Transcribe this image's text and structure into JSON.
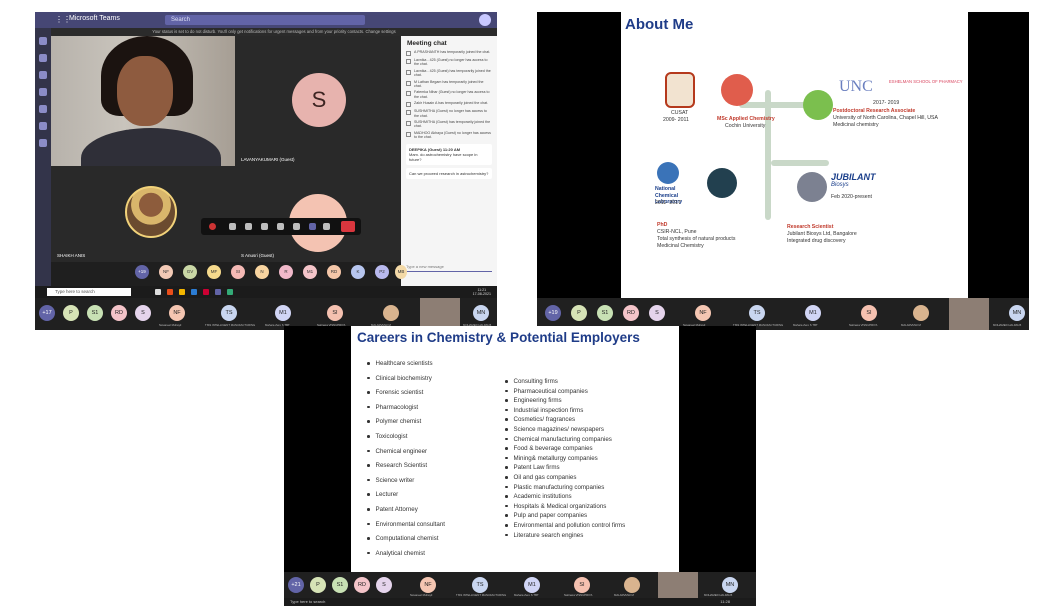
{
  "teams": {
    "app_title": "Microsoft Teams",
    "search_placeholder": "Search",
    "notice": "Your status is set to do not disturb. You'll only get notifications for urgent messages and from your priority contacts. Change settings",
    "tile_woman_label": "",
    "tile_s_label": "LAVANYAKUMARI (Guest)",
    "tile_s_initial": "S",
    "tile_man_label": "SHAIKH ANIS",
    "tile_peach_label": "S Anusri (Guest)",
    "chat_title": "Meeting chat",
    "chat_entries": [
      "A PRASHANTH has temporarily joined the chat.",
      "Lavnika - 425 (Guest) no longer has access to the chat.",
      "Lavnika - 425 (Guest) has temporarily joined the chat.",
      "M Lathan Begam has temporarily joined the chat.",
      "Fatemka Nihar (Guest) no longer has access to the chat.",
      "Zakir Husain A has temporarily joined the chat.",
      "SUSHMITHA (Guest) no longer has access to the chat.",
      "SUSHMITHA (Guest) has temporarily joined the chat.",
      "MADHOO Akhaya (Guest) no longer has access to the chat."
    ],
    "chat_msg_author": "DEEPIKA (Guest)  11:20 AM",
    "chat_msg_1": "Mam. do astrochemistry have scope in future?",
    "chat_msg_2": "Can we proceed research in astrochemistry?",
    "chat_input_placeholder": "Type a new message",
    "participants": [
      "+19",
      "NF",
      "GV",
      "MF",
      "SI",
      "N",
      "R",
      "M1",
      "RD",
      "K",
      "P2",
      "MB"
    ],
    "taskbar_search": "Type here to search",
    "taskbar_time": "11:21",
    "taskbar_date": "17-08-2021"
  },
  "gallery1": {
    "buttons": [
      "+17",
      "P",
      "S1",
      "RD",
      "S",
      "NF",
      "TS",
      "M1",
      "SI",
      "",
      "MN"
    ],
    "names": [
      "Navaneel Muhayil",
      "TISS INTELLIGENT MANUFACTURING",
      "Mahara Zero S TBT",
      "Nalinaxa VISNUPRIYA",
      "MALARVIZHI M",
      "MOHAMED HALIMA B"
    ]
  },
  "about": {
    "title": "About Me",
    "cusat_label": "CUSAT",
    "cusat_years": "2009- 2011",
    "msc_title": "MSc Applied Chemistry",
    "msc_place": "Cochin University",
    "unc_logo": "UNC",
    "unc_school": "ESHELMAN SCHOOL OF PHARMACY",
    "unc_years": "2017- 2019",
    "postdoc_title": "Postdoctoral Research Associate",
    "postdoc_place": "University of North Carolina, Chapel Hill, USA",
    "postdoc_field": "Medicinal chemistry",
    "ncl_name": "National Chemical Laboratory",
    "ncl_years": "2011- 2017",
    "phd_title": "PhD",
    "phd_place": "CSIR-NCL, Pune",
    "phd_topic1": "Total synthesis of natural products",
    "phd_topic2": "Medicinal Chemistry",
    "jubilant_name": "JUBILANT",
    "jubilant_sub": "Biosys",
    "jubilant_years": "Feb 2020-present",
    "rs_title": "Research Scientist",
    "rs_place": "Jubilant Biosys Ltd, Bangalore",
    "rs_field": "Integrated drug discovery"
  },
  "gallery2": {
    "buttons": [
      "+19",
      "P",
      "S1",
      "RD",
      "S",
      "NF",
      "TS",
      "M1",
      "SI",
      "",
      "MN"
    ],
    "names": [
      "Navaneel Muhayil",
      "TISS INTELLIGENT MANUFACTURING",
      "Mahara Zero S TBT",
      "Nalinaxa VISNUPRIYA",
      "MALARVIZHI M",
      "MOHAMED HALIMA B"
    ]
  },
  "careers": {
    "title": "Careers in Chemistry & Potential Employers",
    "left": [
      "Healthcare scientists",
      "Clinical biochemistry",
      "Forensic scientist",
      "Pharmacologist",
      "Polymer chemist",
      "Toxicologist",
      "Chemical engineer",
      "Research Scientist",
      "Science writer",
      "Lecturer",
      "Patent Attorney",
      "Environmental consultant",
      "Computational chemist",
      "Analytical chemist"
    ],
    "right": [
      "Consulting firms",
      "Pharmaceutical companies",
      "Engineering firms",
      "Industrial inspection firms",
      "Cosmetics/ fragrances",
      "Science magazines/ newspapers",
      "Chemical manufacturing companies",
      "Food & beverage companies",
      "Mining& metallurgy companies",
      "Patent Law firms",
      "Oil and gas companies",
      "Plastic manufacturing companies",
      "Academic institutions",
      "Hospitals & Medical organizations",
      "Pulp and paper companies",
      "Environmental and pollution control firms",
      "Literature search engines"
    ]
  },
  "gallery3": {
    "buttons": [
      "+21",
      "P",
      "S1",
      "RD",
      "S",
      "NF",
      "TS",
      "M1",
      "SI",
      "",
      "MN"
    ],
    "names": [
      "Navaneel Muhayil",
      "TISS INTELLIGENT MANUFACTURING",
      "Mahara Zero S TBT",
      "Nalinaxa VISNUPRIYA",
      "MALARVIZHI M",
      "MOHAMED HALIMA B"
    ],
    "taskbar_search": "Type here to search",
    "taskbar_time": "11:28"
  },
  "colors": {
    "teams_purple": "#464775",
    "slide_title_blue": "#1f3c88",
    "accent_red": "#c0392b"
  }
}
